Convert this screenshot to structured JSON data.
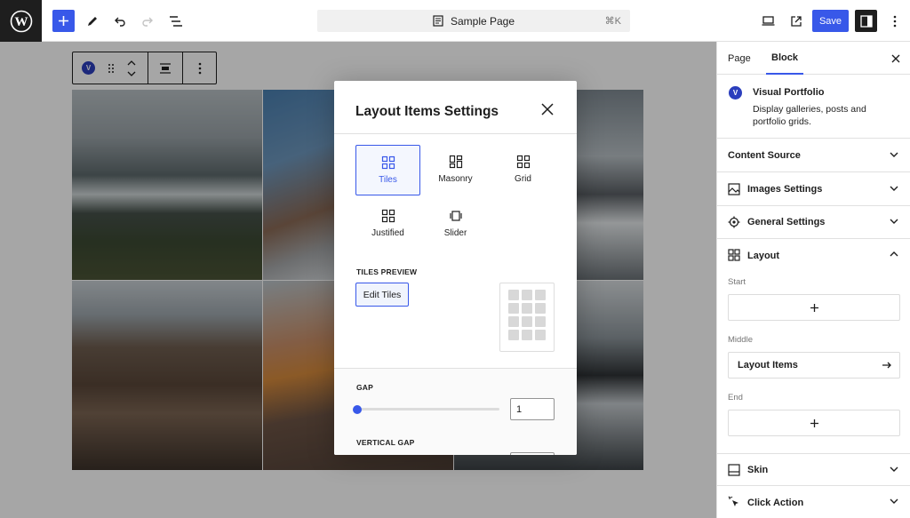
{
  "header": {
    "document_title": "Sample Page",
    "shortcut": "⌘K",
    "save_label": "Save"
  },
  "sidebar": {
    "tabs": [
      "Page",
      "Block"
    ],
    "active_tab": "Block",
    "block": {
      "badge": "V",
      "title": "Visual Portfolio",
      "description": "Display galleries, posts and portfolio grids."
    },
    "panels": {
      "content_source": "Content Source",
      "images_settings": "Images Settings",
      "general_settings": "General Settings",
      "layout": "Layout",
      "skin": "Skin",
      "click_action": "Click Action"
    },
    "layout": {
      "start_label": "Start",
      "middle_label": "Middle",
      "end_label": "End",
      "layout_items_label": "Layout Items"
    }
  },
  "block_toolbar": {
    "badge": "V"
  },
  "modal": {
    "title": "Layout Items Settings",
    "options": [
      {
        "label": "Tiles",
        "selected": true
      },
      {
        "label": "Masonry",
        "selected": false
      },
      {
        "label": "Grid",
        "selected": false
      },
      {
        "label": "Justified",
        "selected": false
      },
      {
        "label": "Slider",
        "selected": false
      }
    ],
    "tiles_preview_label": "TILES PREVIEW",
    "edit_tiles_label": "Edit Tiles",
    "gap_label": "GAP",
    "gap_value": "1",
    "vertical_gap_label": "VERTICAL GAP"
  },
  "colors": {
    "accent": "#3858e9",
    "dark": "#1e1e1e",
    "badge": "#2b3ebd"
  }
}
